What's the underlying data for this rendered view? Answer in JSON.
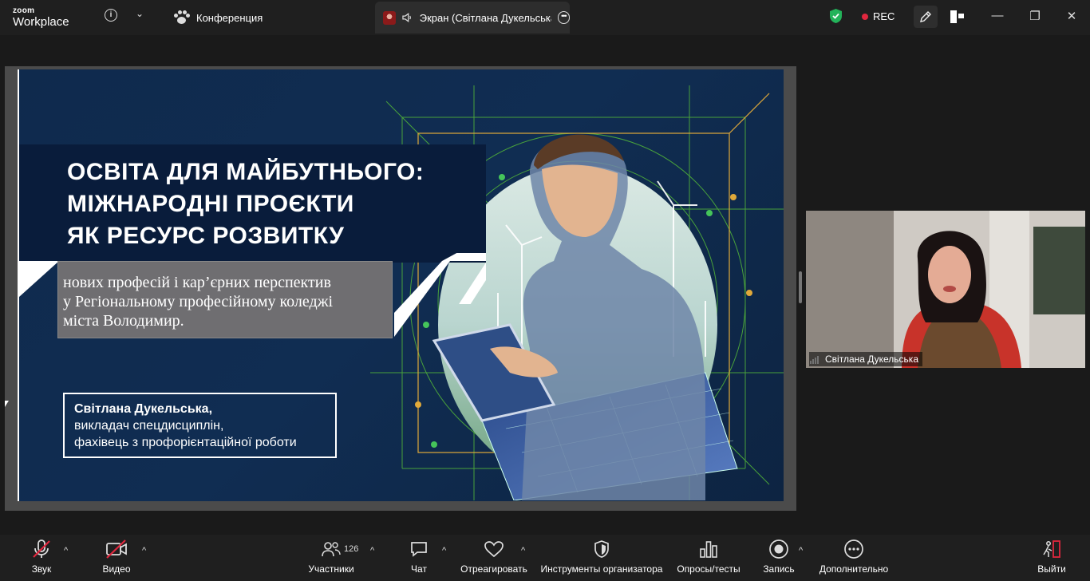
{
  "app": {
    "brand_top": "zoom",
    "brand_bottom": "Workplace"
  },
  "tabs": {
    "conference": "Конференция",
    "screen": "Экран (Світлана Дукельська"
  },
  "status": {
    "rec": "REC"
  },
  "slide": {
    "title_lines": [
      "ОСВІТА ДЛЯ МАЙБУТНЬОГО:",
      "МІЖНАРОДНІ ПРОЄКТИ",
      "ЯК РЕСУРС РОЗВИТКУ"
    ],
    "subtitle_lines": [
      "нових професій і кар’єрних перспектив",
      "у Регіональному професійному коледжі",
      "міста Володимир."
    ],
    "author_name": "Світлана Дукельська,",
    "author_role_lines": [
      "викладач спецдисциплін,",
      "фахівець з профорієнтаційної роботи"
    ]
  },
  "video": {
    "participant_name": "Світлана Дукельська"
  },
  "toolbar": {
    "audio": "Звук",
    "video": "Видео",
    "participants": "Участники",
    "participants_count": "126",
    "chat": "Чат",
    "react": "Отреагировать",
    "host_tools": "Инструменты организатора",
    "polls": "Опросы/тесты",
    "record": "Запись",
    "more": "Дополнительно",
    "leave": "Выйти"
  },
  "colors": {
    "rec_dot": "#e0273e",
    "shield": "#23b35a",
    "leave": "#e0273e",
    "mute_slash": "#e0273e"
  }
}
